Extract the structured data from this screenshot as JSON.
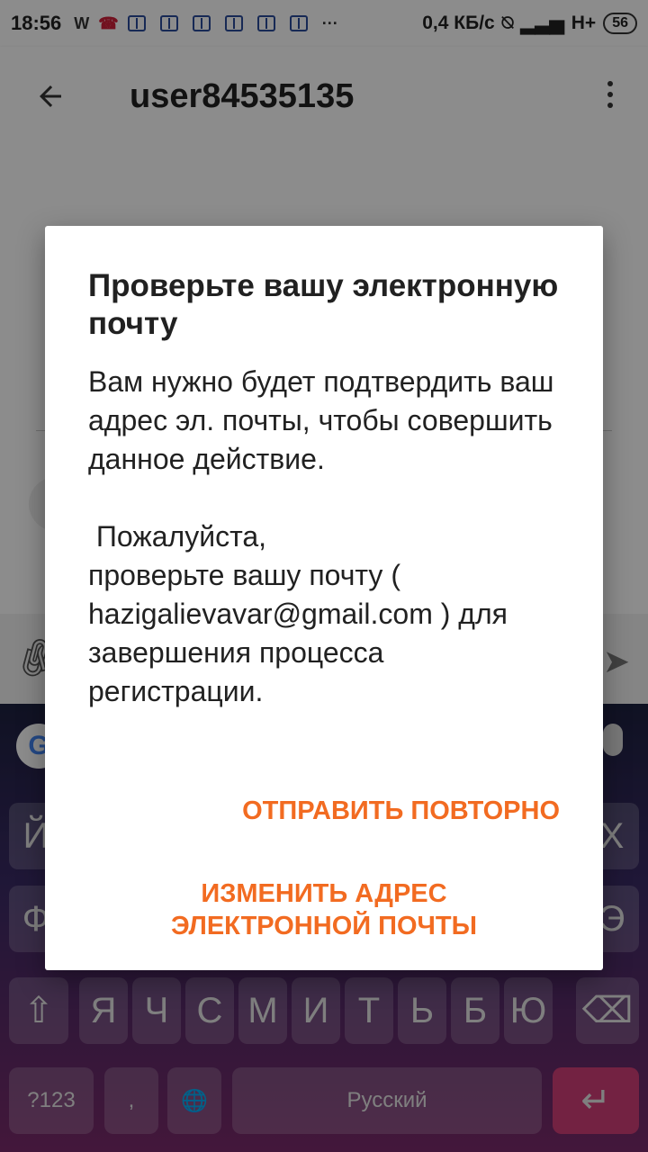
{
  "status_bar": {
    "time": "18:56",
    "speed": "0,4 КБ/с",
    "network": "H+",
    "battery": "56"
  },
  "app_bar": {
    "title": "user84535135"
  },
  "dialog": {
    "title": "Проверьте вашу электронную почту",
    "body_line1": "Вам нужно будет подтвердить ваш адрес эл. почты, чтобы совершить данное действие.",
    "body_line2": " Пожалуйста,",
    "body_line3": "проверьте вашу почту ( hazigalievavar@gmail.com ) для завершения процесса регистрации.",
    "resend_label": "ОТПРАВИТЬ ПОВТОРНО",
    "change_label": "ИЗМЕНИТЬ АДРЕС ЭЛЕКТРОННОЙ ПОЧТЫ"
  },
  "keyboard": {
    "row1_first": "Й",
    "row1_last": "Х",
    "row2_first": "Ф",
    "row2_last": "Э",
    "row3": [
      "Я",
      "Ч",
      "С",
      "М",
      "И",
      "Т",
      "Ь",
      "Б",
      "Ю"
    ],
    "numbers_label": "?123",
    "comma_label": ",",
    "space_label": "Русский",
    "period_label": "."
  },
  "colors": {
    "accent": "#f26b21",
    "enter_key": "#d23e79"
  }
}
